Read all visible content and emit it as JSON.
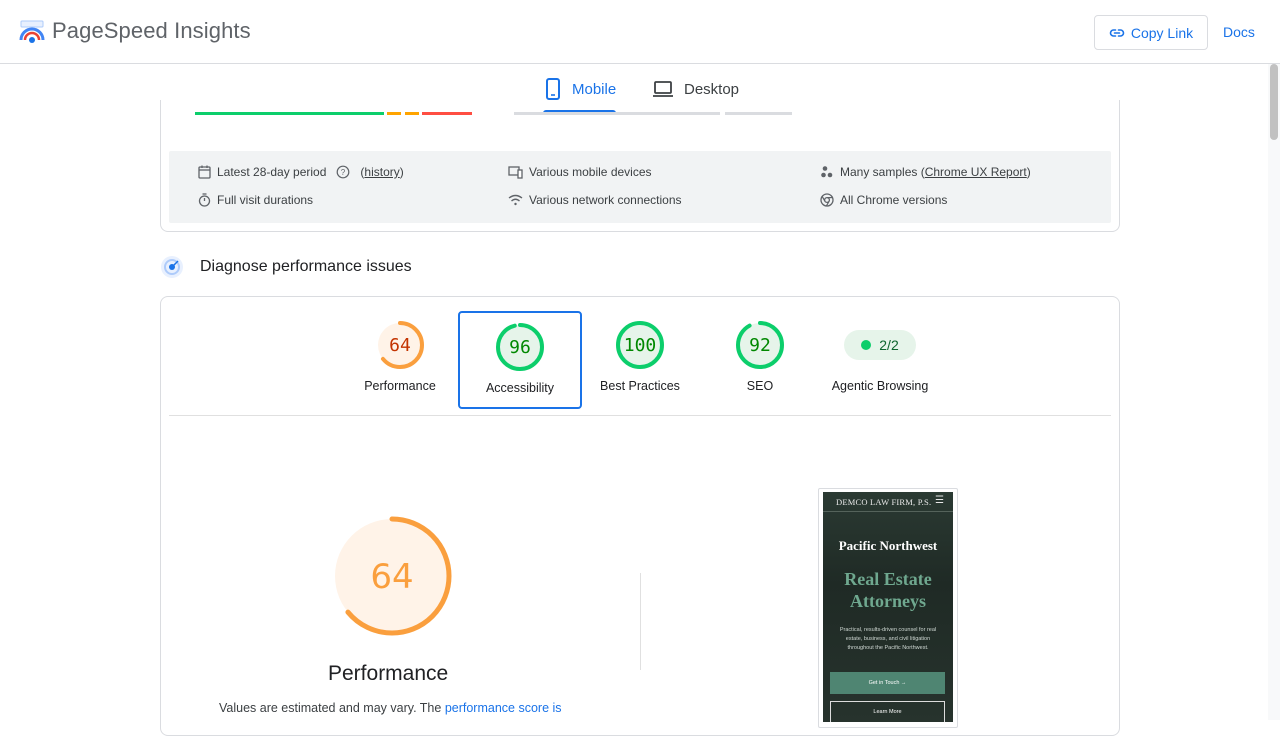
{
  "header": {
    "title": "PageSpeed Insights",
    "copy_link": "Copy Link",
    "docs": "Docs"
  },
  "tabs": [
    {
      "label": "Mobile",
      "icon": "smartphone-icon",
      "selected": true
    },
    {
      "label": "Desktop",
      "icon": "laptop-icon",
      "selected": false
    }
  ],
  "field_data_info": {
    "period": "Latest 28-day period",
    "history_link": "history",
    "full_visit": "Full visit durations",
    "devices": "Various mobile devices",
    "network": "Various network connections",
    "samples_prefix": "Many samples (",
    "samples_link": "Chrome UX Report",
    "samples_suffix": ")",
    "chrome_versions": "All Chrome versions"
  },
  "diagnose": {
    "title": "Diagnose performance issues"
  },
  "scores": [
    {
      "label": "Performance",
      "score": "64",
      "fraction": 0.64,
      "color": "#fa9f3e",
      "text_color": "#c33300",
      "bg": "#fff3e8"
    },
    {
      "label": "Accessibility",
      "score": "96",
      "fraction": 0.96,
      "color": "#0cce6b",
      "text_color": "#008800",
      "bg": "#e6f4ea",
      "selected": true
    },
    {
      "label": "Best Practices",
      "score": "100",
      "fraction": 1.0,
      "color": "#0cce6b",
      "text_color": "#008800",
      "bg": "#e6f4ea"
    },
    {
      "label": "SEO",
      "score": "92",
      "fraction": 0.92,
      "color": "#0cce6b",
      "text_color": "#008800",
      "bg": "#e6f4ea"
    }
  ],
  "agentic": {
    "label": "Agentic Browsing",
    "value": "2/2",
    "color": "#0cce6b"
  },
  "performance_detail": {
    "score": "64",
    "fraction": 0.64,
    "label": "Performance",
    "note_text": "Values are estimated and may vary. The ",
    "note_link": "performance score is"
  },
  "screenshot": {
    "firm": "DEMCO LAW FIRM, P.S.",
    "menu": "☰",
    "heading1": "Pacific Northwest",
    "heading2": "Real Estate Attorneys",
    "paragraph": "Practical, results-driven counsel for real estate, business, and civil litigation throughout the Pacific Northwest.",
    "button1": "Get in Touch →",
    "button2": "Learn More"
  },
  "colors": {
    "accent": "#1a73e8",
    "pass": "#0cce6b",
    "average": "#fa9f3e",
    "fail": "#ff4e42"
  }
}
